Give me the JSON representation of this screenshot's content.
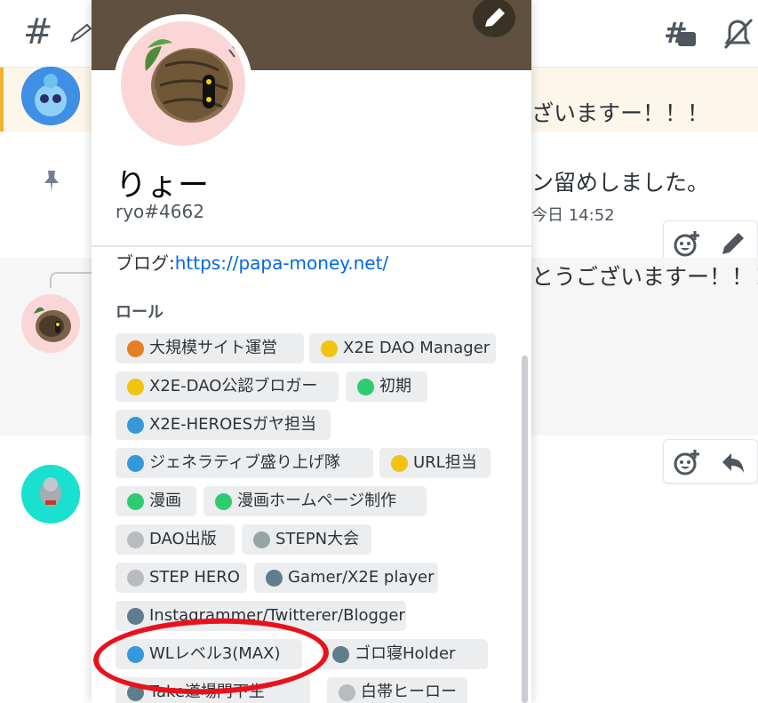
{
  "header": {
    "channel_symbol": "#",
    "threads_icon": "threads-icon",
    "mute_icon": "bell-slash-icon"
  },
  "messages": [
    {
      "text": "ざいますー！！！"
    },
    {
      "text": "ン留めしました。",
      "timestamp": "今日 14:52"
    },
    {
      "text": "とうございますー！！！"
    }
  ],
  "popout": {
    "username": "りょー",
    "tag": "ryo#4662",
    "bio_label": "ブログ:",
    "bio_link": "https://papa-money.net/",
    "roles_heading": "ロール",
    "roles": [
      {
        "name": "大規模サイト運営",
        "color": "#e67e22"
      },
      {
        "name": "X2E DAO Manager",
        "color": "#f1c40f"
      },
      {
        "name": "X2E-DAO公認ブロガー",
        "color": "#f1c40f"
      },
      {
        "name": "初期",
        "color": "#2ecc71"
      },
      {
        "name": "X2E-HEROESガヤ担当",
        "color": "#3498db"
      },
      {
        "name": "ジェネラティブ盛り上げ隊",
        "color": "#3498db"
      },
      {
        "name": "URL担当",
        "color": "#f1c40f"
      },
      {
        "name": "漫画",
        "color": "#2ecc71"
      },
      {
        "name": "漫画ホームページ制作",
        "color": "#2ecc71"
      },
      {
        "name": "DAO出版",
        "color": "#b9bbbe"
      },
      {
        "name": "STEPN大会",
        "color": "#95a5a6"
      },
      {
        "name": "STEP HERO",
        "color": "#b9bbbe"
      },
      {
        "name": "Gamer/X2E player",
        "color": "#607d8b"
      },
      {
        "name": "Instagrammer/Twitterer/Blogger",
        "color": "#607d8b"
      },
      {
        "name": "WLレベル3(MAX)",
        "color": "#3498db"
      },
      {
        "name": "ゴロ寝Holder",
        "color": "#607d8b"
      },
      {
        "name": "Take道場門下生",
        "color": "#607d8b"
      },
      {
        "name": "白帯ヒーロー",
        "color": "#b9bbbe"
      }
    ]
  },
  "colors": {
    "banner": "#5f5040",
    "highlight": "#e8121c",
    "link": "#0068e0"
  }
}
